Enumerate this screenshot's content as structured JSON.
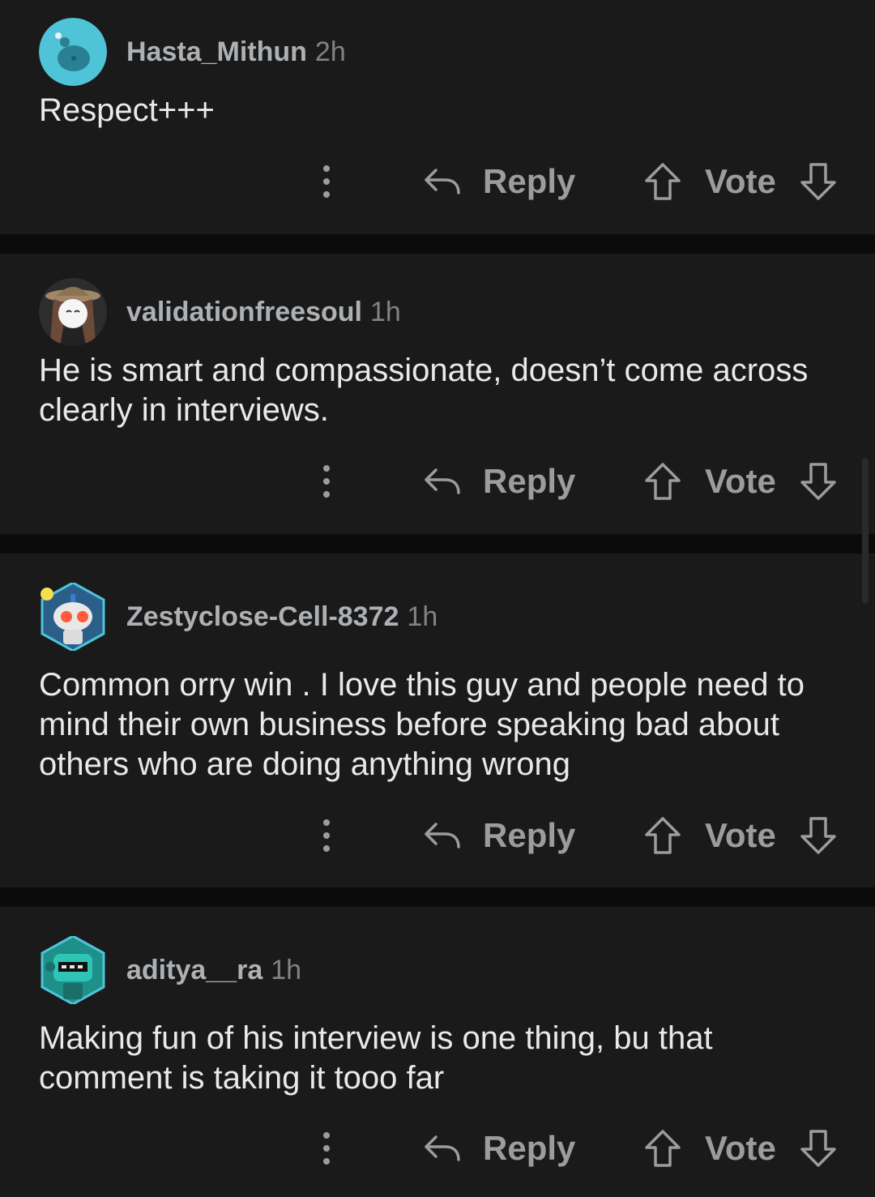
{
  "actions": {
    "reply_label": "Reply",
    "vote_label": "Vote",
    "more_icon": "more-vertical-icon",
    "reply_icon": "reply-arrow-icon",
    "upvote_icon": "upvote-arrow-icon",
    "downvote_icon": "downvote-arrow-icon"
  },
  "colors": {
    "page_background": "#0b0b0b",
    "card_background": "#1a1a1b",
    "username": "#aeb1b3",
    "action": "#9a9c9e"
  },
  "comments": [
    {
      "username": "Hasta_Mithun",
      "time": "2h",
      "text": "Respect+++"
    },
    {
      "username": "validationfreesoul",
      "time": "1h",
      "text": "He is smart and compassionate, doesn’t come across clearly in interviews."
    },
    {
      "username": "Zestyclose-Cell-8372",
      "time": "1h",
      "text": "Common orry win . I love this guy and people need to mind their own business before speaking bad about others who are doing anything wrong"
    },
    {
      "username": "aditya__ra",
      "time": "1h",
      "text": "Making fun of his interview is one thing, bu that comment is taking it tooo far"
    }
  ]
}
